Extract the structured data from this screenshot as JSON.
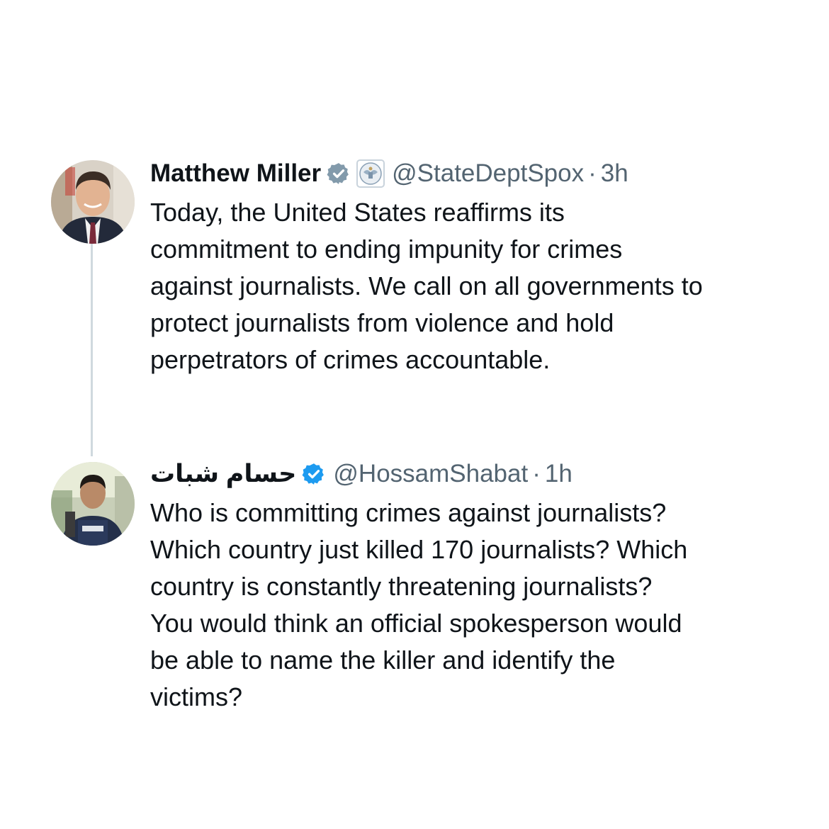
{
  "tweets": [
    {
      "name": "Matthew Miller",
      "handle": "@StateDeptSpox",
      "separator": "·",
      "time": "3h",
      "verified_badge": "verified-badge-icon",
      "affiliation_badge": "state-department-seal-icon",
      "text": "Today, the United States reaffirms its\ncommitment to ending impunity for crimes\nagainst journalists. We call on all governments to\nprotect journalists from violence and hold\nperpetrators of crimes accountable."
    },
    {
      "name": "حسام شبات",
      "handle": "@HossamShabat",
      "separator": "·",
      "time": "1h",
      "verified_badge": "verified-badge-icon",
      "text": "Who is committing crimes against journalists?\nWhich country just killed 170 journalists? Which\ncountry is constantly threatening journalists?\nYou would think an official spokesperson would\nbe able to name the killer and identify the\nvictims?"
    }
  ],
  "colors": {
    "text_primary": "#0f1419",
    "text_secondary": "#536471",
    "verified_blue": "#1d9bf0",
    "thread_line": "#cfd9de"
  }
}
